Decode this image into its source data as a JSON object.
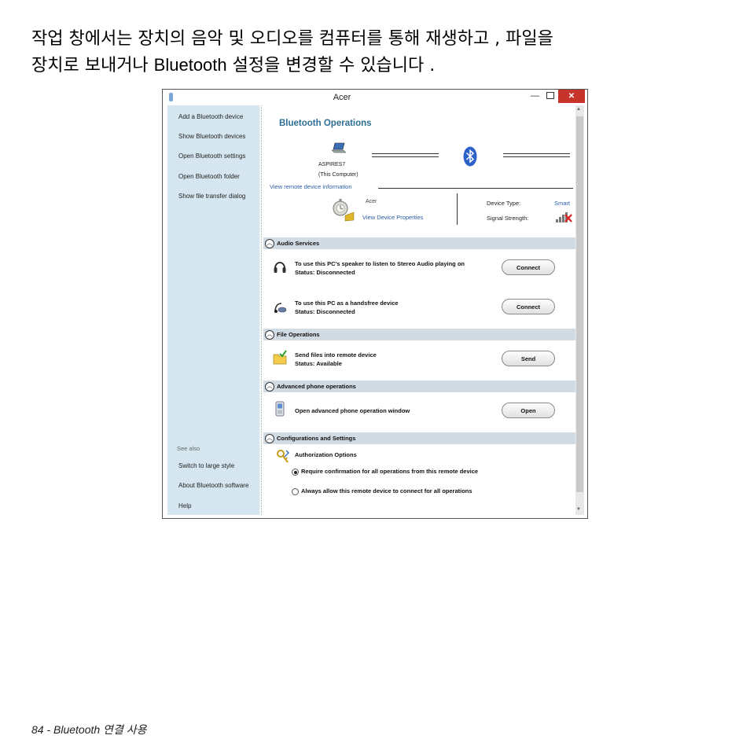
{
  "intro": {
    "text_line1": "작업 창에서는 장치의 음악 및 오디오를 컴퓨터를 통해 재생하고 , 파일을",
    "text_line2_pre": "장치로 보내거나 ",
    "text_line2_latin": "Bluetooth",
    "text_line2_post": " 설정을 변경할 수 있습니다 ."
  },
  "window": {
    "title": "Acer",
    "min_glyph": "—",
    "close_glyph": "✕"
  },
  "sidebar": {
    "tasks": [
      "Add a Bluetooth device",
      "Show Bluetooth devices",
      "Open Bluetooth settings",
      "Open Bluetooth folder",
      "Show file transfer dialog"
    ],
    "see_also_label": "See also",
    "see_also": [
      "Switch to large style",
      "About Bluetooth software",
      "Help"
    ]
  },
  "header": {
    "title": "Bluetooth Operations",
    "computer_name": "ASPIRES7",
    "computer_sub": "(This Computer)",
    "remote_link": "View remote device information",
    "device_name": "Acer",
    "props_link": "View Device Properties",
    "device_type_label": "Device Type:",
    "device_type_value": "Smart",
    "signal_label": "Signal Strength:"
  },
  "sections": {
    "audio": {
      "title": "Audio Services",
      "row1_main": "To use this PC's speaker to listen to Stereo Audio playing on",
      "row1_status": "Status:   Disconnected",
      "row1_button": "Connect",
      "row2_main": "To use this PC as a handsfree device",
      "row2_status": "Status:   Disconnected",
      "row2_button": "Connect"
    },
    "file": {
      "title": "File Operations",
      "row_main": "Send files into remote device",
      "row_status": "Status:   Available",
      "row_button": "Send"
    },
    "phone": {
      "title": "Advanced phone operations",
      "row_main": "Open advanced phone operation window",
      "row_button": "Open"
    },
    "config": {
      "title": "Configurations and Settings",
      "auth_title": "Authorization Options",
      "option1": "Require confirmation for all operations from this remote device",
      "option2": "Always allow this remote device to connect for all operations",
      "selected": 1
    }
  },
  "footer": {
    "text": "84 - Bluetooth 연결 사용"
  },
  "colors": {
    "sidebar_bg": "#d5e6f0",
    "section_bg": "#d1dbe4",
    "link": "#2a5ea8",
    "title": "#2f6f93",
    "close": "#c7342c"
  }
}
